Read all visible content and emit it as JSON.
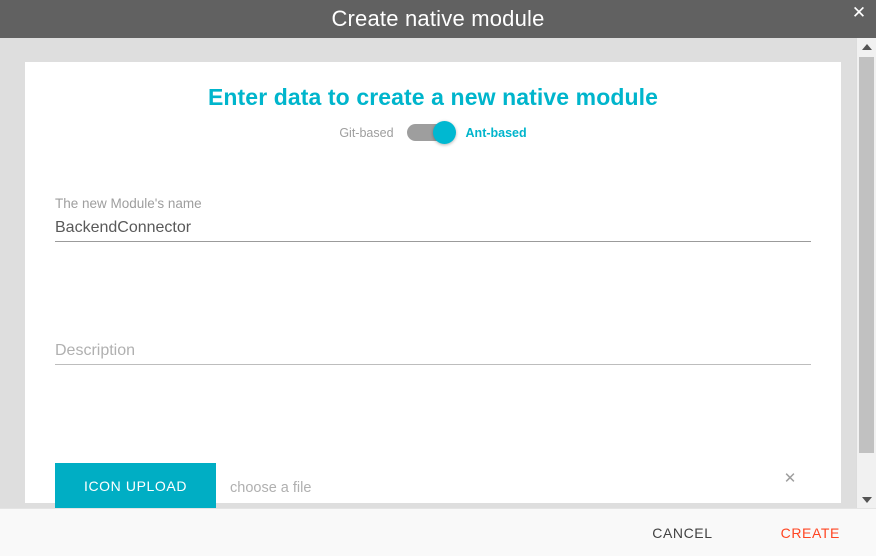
{
  "titlebar": {
    "title": "Create native module",
    "close_icon": "close-icon",
    "close_glyph": "✕"
  },
  "card": {
    "heading": "Enter data to create a new native module",
    "toggle": {
      "left_label": "Git-based",
      "right_label": "Ant-based",
      "state": "right",
      "active_option": "Ant-based"
    },
    "fields": [
      {
        "label": "The new Module's name",
        "value": "BackendConnector",
        "placeholder": ""
      },
      {
        "label": "",
        "value": "",
        "placeholder": "Description"
      }
    ],
    "upload": {
      "button_label": "ICON UPLOAD",
      "file_placeholder": "choose a file",
      "file_value": "",
      "clear_icon": "close-icon",
      "clear_glyph": "✕"
    }
  },
  "scrollbar": {
    "up_icon": "triangle-up-icon",
    "down_icon": "triangle-down-icon"
  },
  "footer": {
    "cancel_label": "CANCEL",
    "create_label": "CREATE"
  },
  "colors": {
    "titlebar_bg": "#616161",
    "accent_teal": "#00b5cc",
    "button_teal": "#00aec4",
    "create_orange": "#ff4522",
    "backdrop_gray": "#dedede",
    "footer_bg": "#f9f9f9"
  }
}
